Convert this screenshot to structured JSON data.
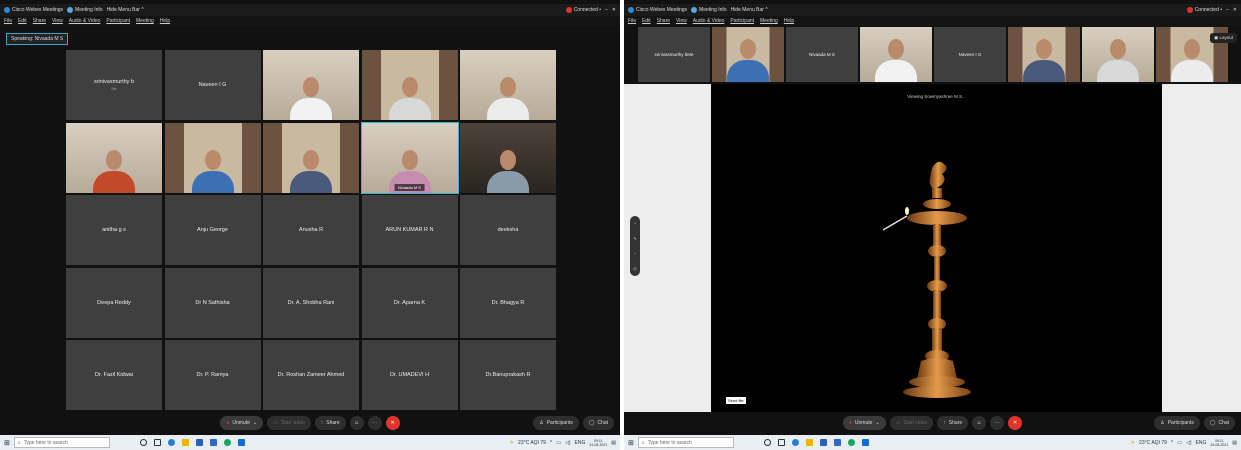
{
  "left": {
    "title": {
      "app_name": "Cisco Webex Meetings",
      "meeting_info": "Meeting Info",
      "hide_menu_bar": "Hide Menu Bar ^",
      "connected": "Connected •"
    },
    "menu": [
      "File",
      "Edit",
      "Share",
      "View",
      "Audio & Video",
      "Participant",
      "Meeting",
      "Help"
    ],
    "speaking": "Speaking: Nivaada M S",
    "tiles": [
      {
        "name": "srinivasmurthy b",
        "sub": "Me",
        "type": "name"
      },
      {
        "name": "Naveen I G",
        "type": "name"
      },
      {
        "type": "video",
        "style": "v-wall",
        "body_color": "#f2f2f2"
      },
      {
        "type": "video",
        "style": "v-shelf",
        "body_color": "#d8d8d8"
      },
      {
        "type": "video",
        "style": "v-wall",
        "body_color": "#ececec"
      },
      {
        "type": "video",
        "style": "v-wall",
        "body_color": "#c24a2a"
      },
      {
        "type": "video",
        "style": "v-shelf",
        "body_color": "#3c6fb4"
      },
      {
        "type": "video",
        "style": "v-shelf",
        "body_color": "#4a5a7a"
      },
      {
        "type": "video",
        "style": "v-wall",
        "body_color": "#c78db0",
        "caption": "Nivaada M S",
        "active": true
      },
      {
        "type": "video",
        "style": "v-dark",
        "body_color": "#8a9aa8"
      },
      {
        "name": "anitha g s",
        "type": "name"
      },
      {
        "name": "Anju George",
        "type": "name"
      },
      {
        "name": "Anusha R",
        "type": "name"
      },
      {
        "name": "ARUN KUMAR R N",
        "type": "name"
      },
      {
        "name": "deeksha",
        "type": "name"
      },
      {
        "name": "Deepa Reddy",
        "type": "name"
      },
      {
        "name": "Dr N Sathisha",
        "type": "name"
      },
      {
        "name": "Dr. A. Shobha Rani",
        "type": "name"
      },
      {
        "name": "Dr. Aparna K",
        "type": "name"
      },
      {
        "name": "Dr. Bhagya R",
        "type": "name"
      },
      {
        "name": "Dr. Fazil Kidwai",
        "type": "name"
      },
      {
        "name": "Dr. P. Ramya",
        "type": "name"
      },
      {
        "name": "Dr. Roshan Zameer Ahmed",
        "type": "name"
      },
      {
        "name": "Dr. UMADEVI H",
        "type": "name"
      },
      {
        "name": "Dr.Banuprakash R",
        "type": "name"
      }
    ],
    "controls": {
      "unmute": "Unmute",
      "start_video": "Start video",
      "share": "Share",
      "participants": "Participants",
      "chat": "Chat"
    },
    "taskbar": {
      "search_placeholder": "Type here to search",
      "weather": "23°C AQI 79",
      "lang": "ENG",
      "time": "09:11",
      "date": "24-08-2021"
    }
  },
  "right": {
    "title": {
      "app_name": "Cisco Webex Meetings",
      "meeting_info": "Meeting Info",
      "hide_menu_bar": "Hide Menu Bar ^",
      "connected": "Connected •"
    },
    "menu": [
      "File",
      "Edit",
      "Share",
      "View",
      "Audio & Video",
      "Participant",
      "Meeting",
      "Help"
    ],
    "thumbs": [
      {
        "name": "srinivasmurthy b",
        "sub": "Me",
        "type": "name"
      },
      {
        "type": "video",
        "style": "v-shelf",
        "body_color": "#3c6fb4"
      },
      {
        "name": "Nivaada M S",
        "type": "name"
      },
      {
        "type": "video",
        "style": "v-wall",
        "body_color": "#f2f2f2"
      },
      {
        "name": "Naveen I G",
        "type": "name"
      },
      {
        "type": "video",
        "style": "v-shelf",
        "body_color": "#4a5a7a"
      },
      {
        "type": "video",
        "style": "v-wall",
        "body_color": "#d8d8d8"
      },
      {
        "type": "video",
        "style": "v-shelf",
        "body_color": "#ececec"
      }
    ],
    "layout_label": "Layout",
    "viewing": "Viewing Sowmyashree M S...",
    "tooltip": "Send file",
    "controls": {
      "unmute": "Unmute",
      "start_video": "Start video",
      "share": "Share",
      "participants": "Participants",
      "chat": "Chat"
    },
    "taskbar": {
      "search_placeholder": "Type here to search",
      "weather": "23°C AQI 79",
      "lang": "ENG",
      "time": "09:11",
      "date": "24-08-2021"
    }
  },
  "colors": {
    "accent": "#39b5d4",
    "leave": "#e0352b",
    "tile": "#3f3f3f",
    "brass": "#b5722b"
  }
}
